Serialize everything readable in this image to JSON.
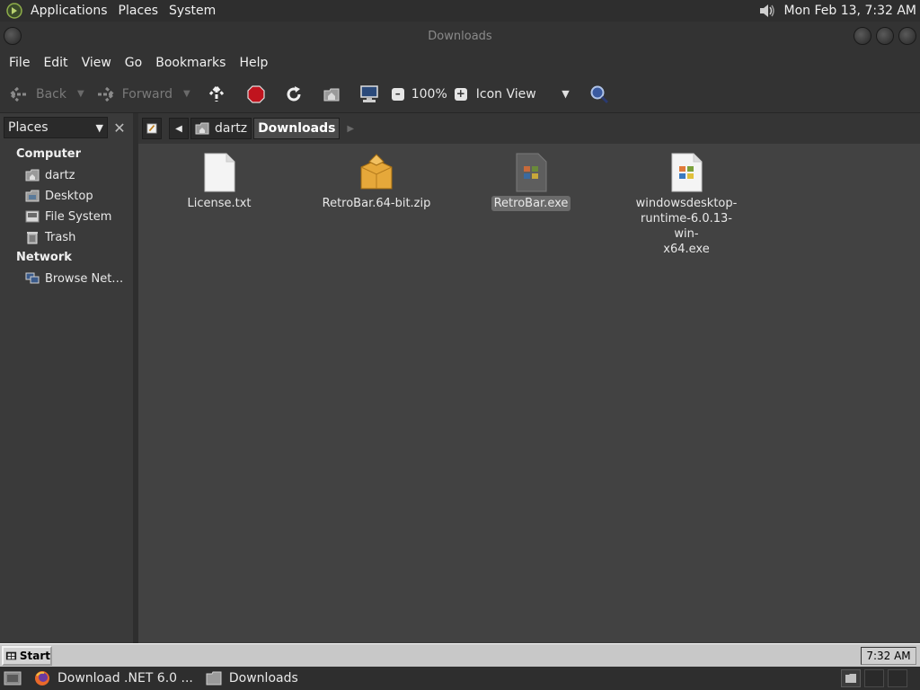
{
  "top_panel": {
    "menus": [
      "Applications",
      "Places",
      "System"
    ],
    "clock": "Mon Feb 13,  7:32 AM"
  },
  "window": {
    "title": "Downloads"
  },
  "menubar": [
    "File",
    "Edit",
    "View",
    "Go",
    "Bookmarks",
    "Help"
  ],
  "toolbar": {
    "back": "Back",
    "forward": "Forward",
    "zoom": "100%",
    "view_mode": "Icon View"
  },
  "sidebar": {
    "header": "Places",
    "sections": [
      {
        "heading": "Computer",
        "items": [
          "dartz",
          "Desktop",
          "File System",
          "Trash"
        ]
      },
      {
        "heading": "Network",
        "items": [
          "Browse Net…"
        ]
      }
    ]
  },
  "pathbar": {
    "crumbs": [
      "dartz",
      "Downloads"
    ]
  },
  "files": [
    {
      "name": "License.txt",
      "icon": "text-file-icon"
    },
    {
      "name": "RetroBar.64-bit.zip",
      "icon": "archive-icon"
    },
    {
      "name": "RetroBar.exe",
      "icon": "executable-icon",
      "selected": true
    },
    {
      "name_lines": [
        "windowsdesktop-",
        "runtime-6.0.13-win-",
        "x64.exe"
      ],
      "icon": "executable-icon"
    }
  ],
  "startbar": {
    "start": "Start",
    "clock": "7:32 AM"
  },
  "taskbar": {
    "items": [
      "Download .NET 6.0 ...",
      "Downloads"
    ]
  },
  "colors": {
    "selection": "#6b6b6b",
    "stop": "#c0141e"
  }
}
